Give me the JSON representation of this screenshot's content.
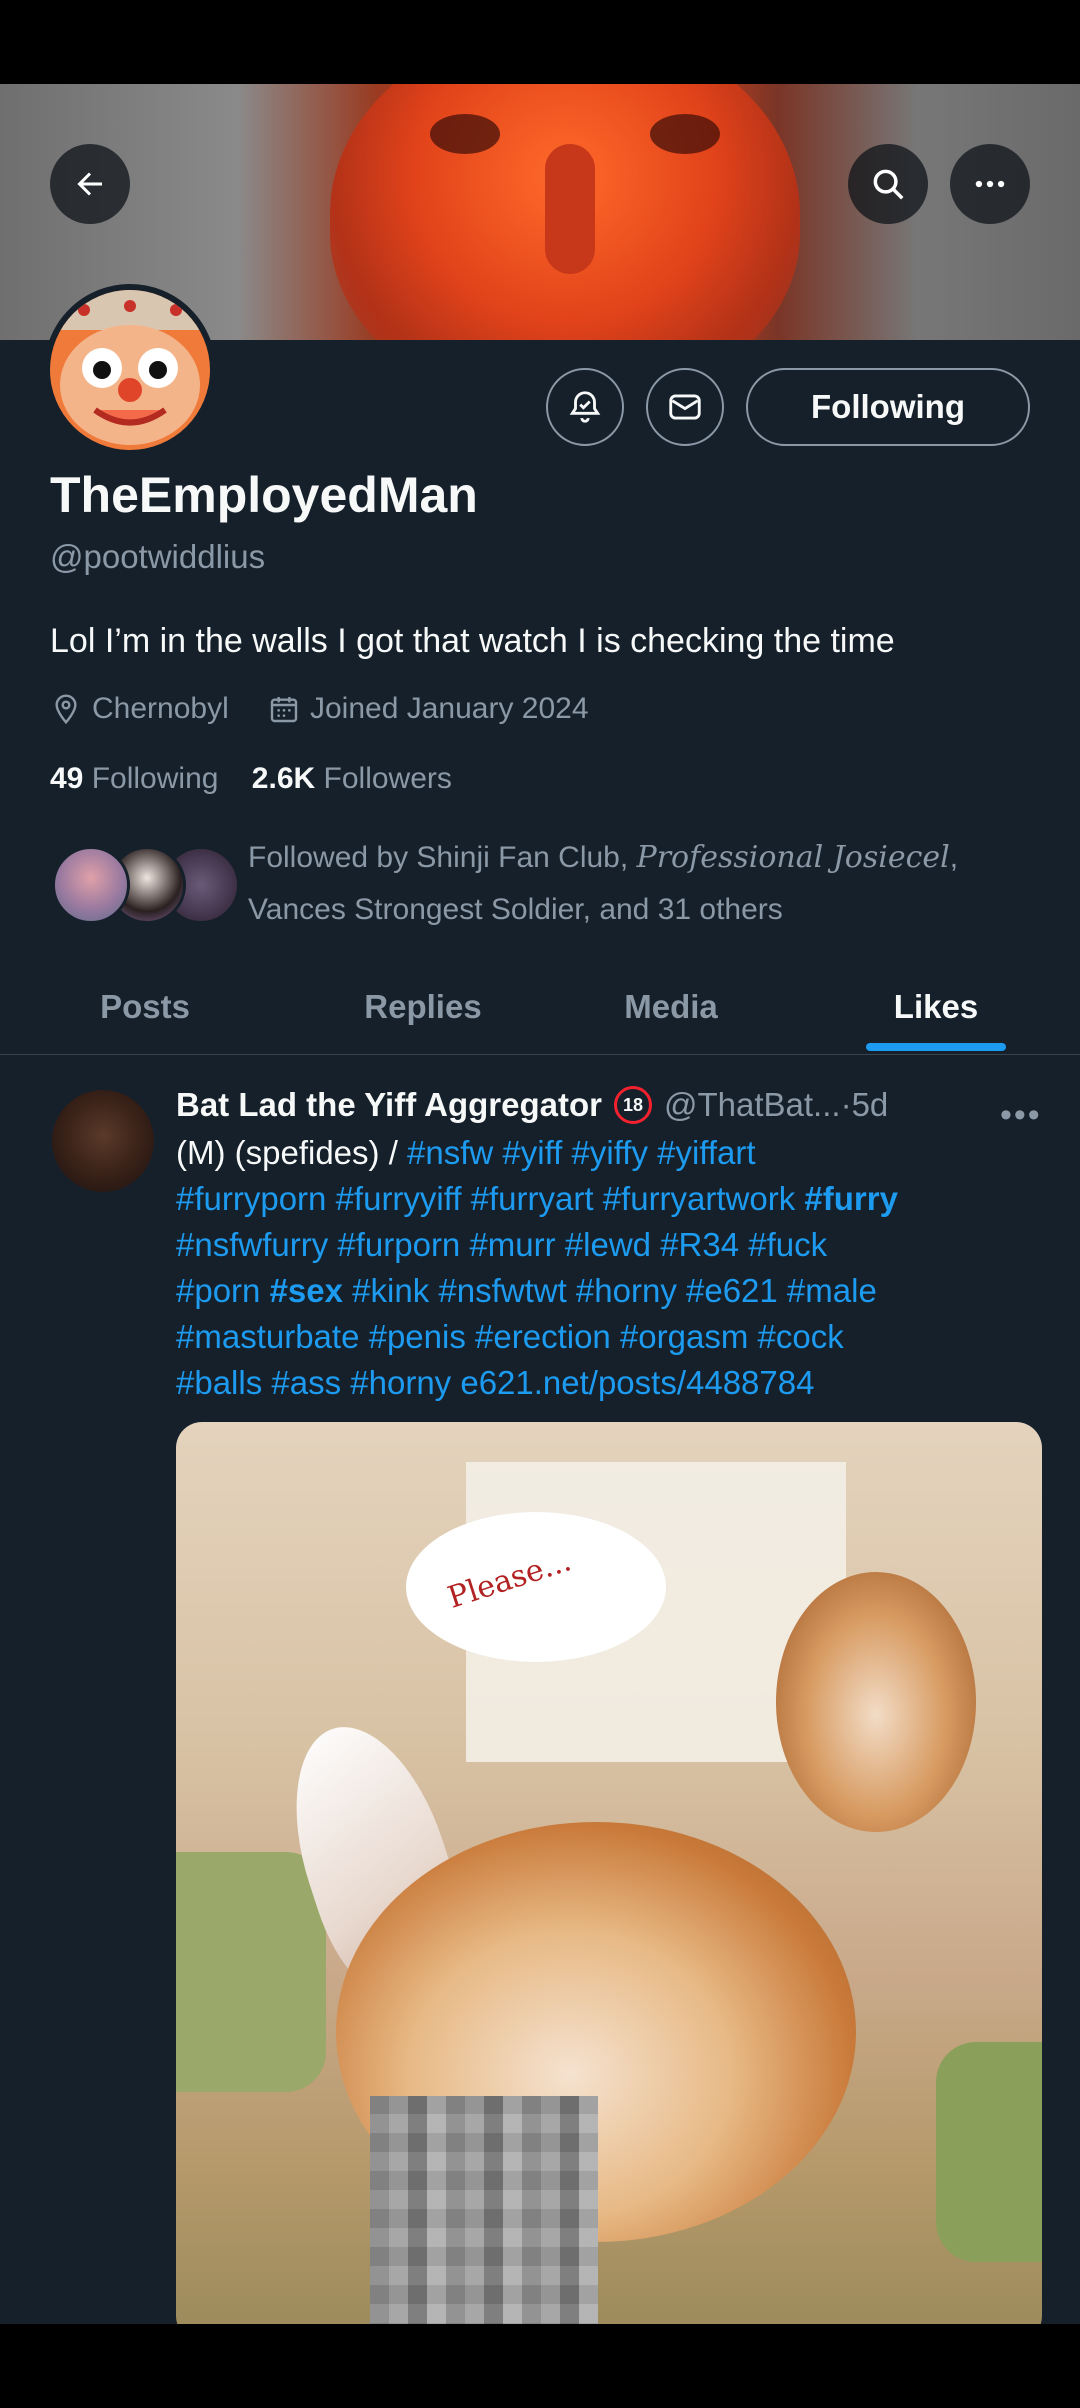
{
  "profile": {
    "display_name": "TheEmployedMan",
    "handle": "@pootwiddlius",
    "bio": "Lol I’m in the walls I got that watch I is checking the time",
    "location": "Chernobyl",
    "joined": "Joined January 2024",
    "following_count": "49",
    "following_label": "Following",
    "followers_count": "2.6K",
    "followers_label": "Followers",
    "followed_by_prefix": "Followed by Shinji Fan Club, ",
    "followed_by_script": "Professional Josiecel",
    "followed_by_suffix": ",",
    "followed_by_line2": "Vances Strongest Soldier, and 31 others",
    "follow_button_label": "Following"
  },
  "tabs": [
    "Posts",
    "Replies",
    "Media",
    "Likes"
  ],
  "active_tab": "Likes",
  "post": {
    "author_name": "Bat Lad the Yiff Aggregator",
    "age_badge": "18",
    "author_handle": "@ThatBat...",
    "separator": " · ",
    "time": "5d",
    "text_prefix": "(M)  (spefides) / ",
    "tags_line1": "#nsfw #yiff #yiffy #yiffart",
    "tags_line2_a": "#furryporn #furryyiff #furryart  #furryartwork ",
    "tags_line2_b": "#furry",
    "tags_line3": "#nsfwfurry #furporn #murr #lewd #R34 #fuck",
    "tags_line4_a": "#porn ",
    "tags_line4_b": "#sex",
    "tags_line4_c": "  #kink #nsfwtwt #horny #e621 #male",
    "tags_line5": "#masturbate #penis #erection #orgasm #cock",
    "tags_line6": "#balls #ass #horny e621.net/posts/4488784",
    "media_caption": "Please..."
  },
  "icons": {
    "back": "arrow-left-icon",
    "search": "search-icon",
    "more": "more-horizontal-icon",
    "notify": "bell-plus-icon",
    "message": "envelope-icon",
    "location": "location-pin-icon",
    "calendar": "calendar-icon"
  },
  "colors": {
    "background": "#15202b",
    "accent": "#1d9bf0",
    "muted": "#8b98a5",
    "text": "#f7f9f9"
  }
}
